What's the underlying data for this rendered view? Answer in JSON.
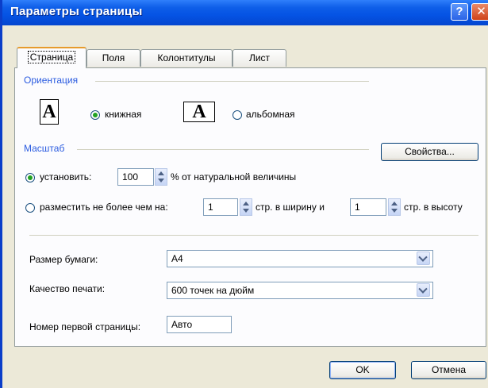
{
  "window": {
    "title": "Параметры страницы",
    "help_glyph": "?",
    "close_glyph": "✕"
  },
  "tabs": [
    {
      "label": "Страница"
    },
    {
      "label": "Поля"
    },
    {
      "label": "Колонтитулы"
    },
    {
      "label": "Лист"
    }
  ],
  "orientation": {
    "group_label": "Ориентация",
    "portrait_glyph": "A",
    "portrait_label": "книжная",
    "landscape_glyph": "A",
    "landscape_label": "альбомная",
    "selected": "portrait"
  },
  "scale": {
    "group_label": "Масштаб",
    "properties_button": "Свойства...",
    "set_label": "установить:",
    "set_value": "100",
    "set_suffix": "% от натуральной величины",
    "fit_label": "разместить не более чем на:",
    "fit_wide_value": "1",
    "fit_wide_suffix": "стр. в ширину и",
    "fit_tall_value": "1",
    "fit_tall_suffix": "стр. в высоту",
    "selected": "set"
  },
  "paper": {
    "label": "Размер бумаги:",
    "value": "A4"
  },
  "quality": {
    "label": "Качество печати:",
    "value": "600 точек на дюйм"
  },
  "first_page": {
    "label": "Номер первой страницы:",
    "value": "Авто"
  },
  "buttons": {
    "ok": "OK",
    "cancel": "Отмена"
  },
  "colors": {
    "titlebar": "#0553e4",
    "group_label": "#2a5be0",
    "radio_dot": "#21a121",
    "tab_highlight": "#e79b2c"
  }
}
